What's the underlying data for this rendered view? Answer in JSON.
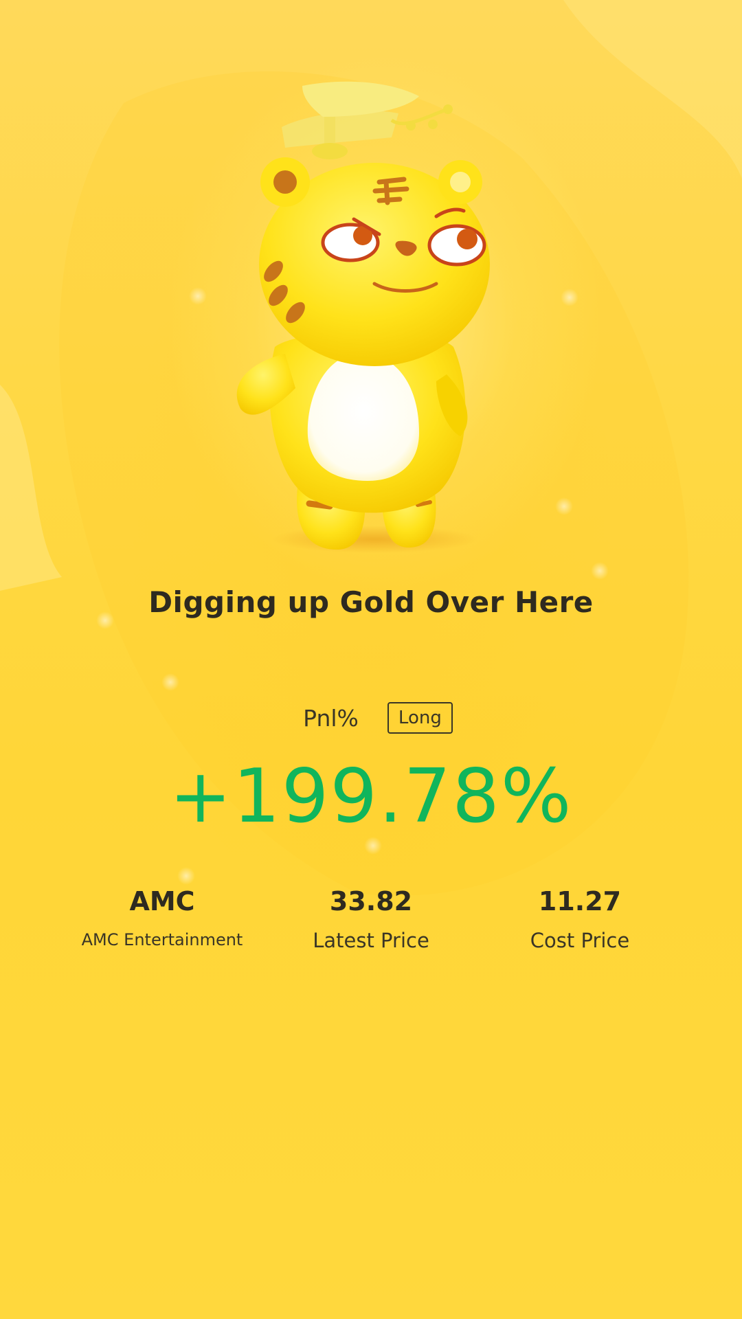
{
  "share_card": {
    "headline": "Digging up Gold Over Here",
    "pnl_label": "Pnl%",
    "position_side": "Long",
    "pnl_value": "+199.78%",
    "stats": [
      {
        "value": "AMC",
        "caption": "AMC Entertainment"
      },
      {
        "value": "33.82",
        "caption": "Latest Price"
      },
      {
        "value": "11.27",
        "caption": "Cost Price"
      }
    ]
  },
  "mascot": {
    "icon": "tiger-mascot-icon"
  },
  "colors": {
    "background": "#FFD845",
    "gain": "#10B55C",
    "text": "#2E2A20"
  }
}
